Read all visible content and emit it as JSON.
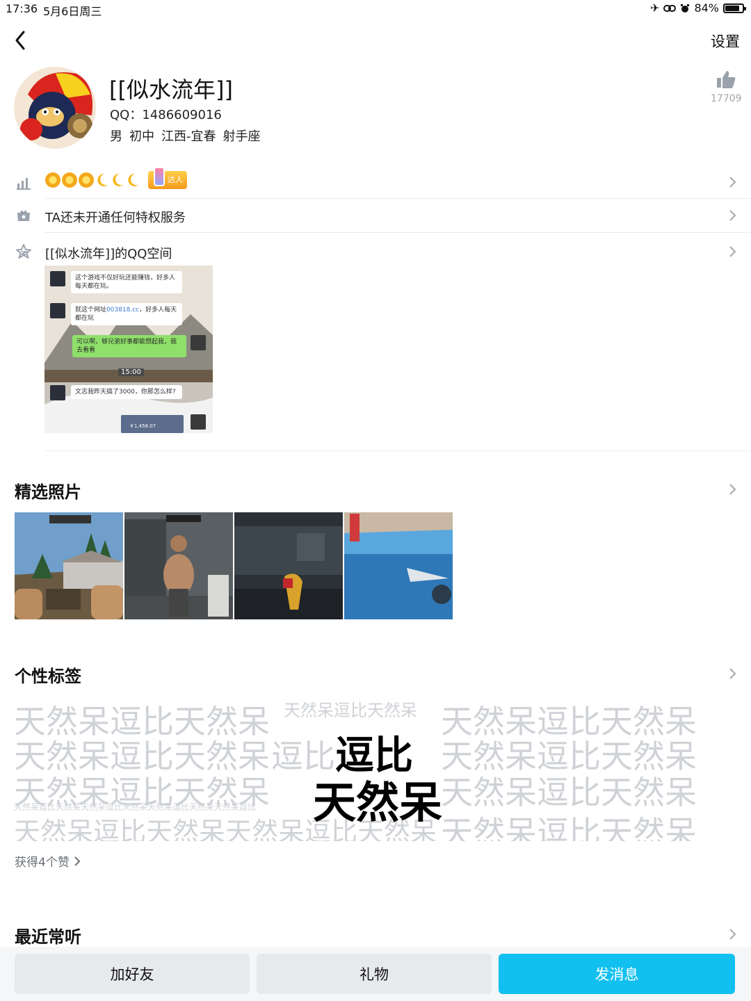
{
  "status_bar": {
    "time": "17:36",
    "date": "5月6日周三",
    "battery": "84%",
    "battery_level": 0.84
  },
  "nav": {
    "settings_label": "设置"
  },
  "profile": {
    "nickname": "[[似水流年]]",
    "qq": "QQ：1486609016",
    "info": [
      "男",
      "初中",
      "江西-宜春",
      "射手座"
    ],
    "like_count": "17709"
  },
  "rows": {
    "level_badge": "达人",
    "privilege": "TA还未开通任何特权服务",
    "qzone": "[[似水流年]]的QQ空间"
  },
  "space_preview": {
    "msg1": "这个游戏不仅好玩还能赚钱，好多人每天都在玩。",
    "msg2_a": "就这个网址",
    "msg2_link": "003818.cc",
    "msg2_b": "，好多人每天都在玩",
    "msg3": "可以啊，够兄弟好事都能想起我，我去看看",
    "time": "15:00",
    "msg4": "文志我昨天搞了3000，你那怎么样?",
    "amount": "￥1,458.07"
  },
  "sections": {
    "photos_title": "精选照片",
    "tags_title": "个性标签",
    "recent_title": "最近常听"
  },
  "tags": {
    "tag1": "逗比",
    "tag2": "天然呆",
    "filler1": "天然呆逗比天然呆",
    "filler2": "天然呆逗比天然呆",
    "filler3": "天然呆逗比天然呆逗比",
    "filler4": "天然呆逗比天然呆",
    "filler5": "天然呆逗比天然呆天然呆逗比天然呆",
    "filler_small1": "天然呆逗比天然呆",
    "filler_small2": "天然呆逗比天然呆天然呆逗比天然呆天然呆逗比天然呆天然呆逗比",
    "right1": "天然呆逗比天然呆",
    "right2": "天然呆逗比天然呆",
    "right3": "天然呆逗比天然呆",
    "right4": "天然呆逗比天然呆",
    "likes_text": "获得4个赞"
  },
  "buttons": {
    "add_friend": "加好友",
    "gift": "礼物",
    "send_message": "发消息"
  },
  "colors": {
    "accent": "#12c0f0",
    "tag_gray": "#cfd2d6",
    "icon_gray": "#9aa3ad"
  },
  "icons": [
    "back-chevron-icon",
    "thumbs-up-icon",
    "level-chart-icon",
    "privilege-bag-icon",
    "qzone-star-icon",
    "chevron-right-icon"
  ]
}
